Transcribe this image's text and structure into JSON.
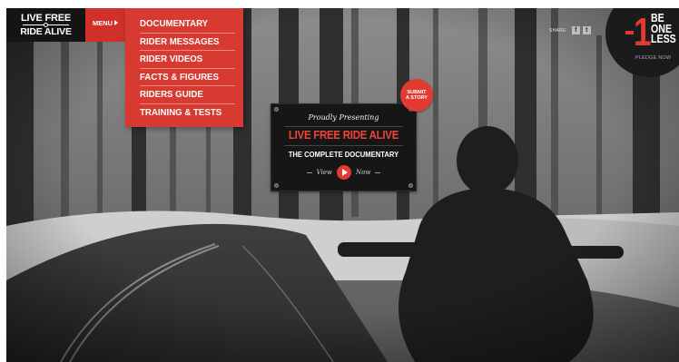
{
  "logo": {
    "line1": "LIVE FREE",
    "line2": "RIDE ALIVE"
  },
  "menu": {
    "label": "MENU",
    "items": [
      {
        "label": "DOCUMENTARY"
      },
      {
        "label": "RIDER MESSAGES"
      },
      {
        "label": "RIDER VIDEOS"
      },
      {
        "label": "FACTS & FIGURES"
      },
      {
        "label": "RIDERS GUIDE"
      },
      {
        "label": "TRAINING & TESTS"
      }
    ]
  },
  "share": {
    "label": "SHARE",
    "icons": [
      "facebook-icon",
      "twitter-icon"
    ]
  },
  "badge": {
    "number": "1",
    "words": [
      "BE",
      "ONE",
      "LESS"
    ],
    "cta": "PLEDGE NOW"
  },
  "feature": {
    "kicker": "Proudly Presenting",
    "title": "LIVE FREE RIDE ALIVE",
    "subtitle": "THE COMPLETE DOCUMENTARY",
    "view_left": "View",
    "view_right": "Now"
  },
  "submit": {
    "line1": "SUBMIT",
    "line2": "A STORY"
  },
  "colors": {
    "accent": "#d63a30",
    "dark": "#141414"
  }
}
